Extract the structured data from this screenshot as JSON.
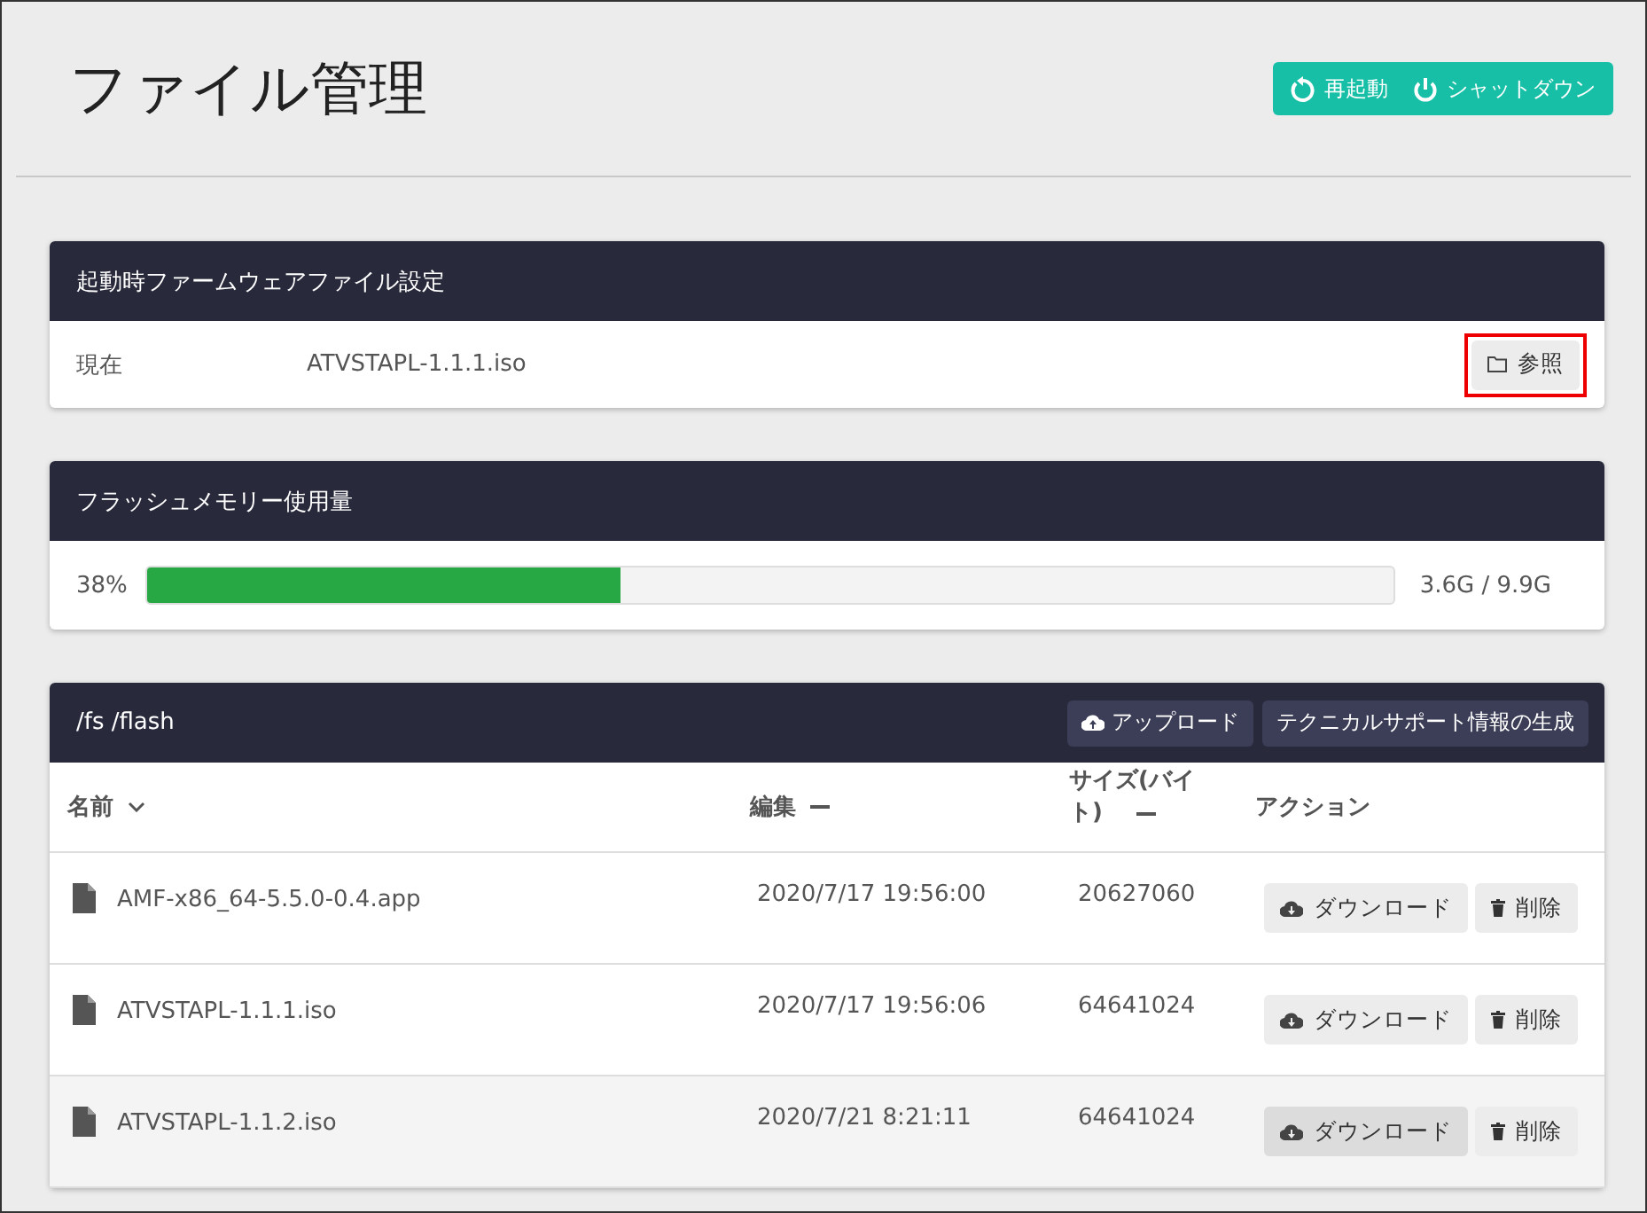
{
  "page": {
    "title": "ファイル管理"
  },
  "header_buttons": [
    {
      "kind": "restart",
      "label": "再起動"
    },
    {
      "kind": "power",
      "label": "シャットダウン"
    }
  ],
  "firmware": {
    "title": "起動時ファームウェアファイル設定",
    "label": "現在",
    "value": "ATVSTAPL-1.1.1.iso",
    "button": {
      "label": "参照",
      "highlighted": true
    }
  },
  "flash": {
    "title": "フラッシュメモリー使用量",
    "percent": "38%",
    "level": 0.38,
    "usage": "3.6G / 9.9G"
  },
  "files": {
    "path": "/fs /flash",
    "buttons": [
      {
        "kind": "upload",
        "label": "アップロード"
      },
      {
        "kind": "plain",
        "label": "テクニカルサポート情報の生成"
      }
    ],
    "columns": [
      {
        "kind": "sortable",
        "label": "名前",
        "sorted": true
      },
      {
        "kind": "sortable",
        "label": "編集",
        "sorted": false
      },
      {
        "kind": "sortable",
        "label": "サイズ(バイト)",
        "sorted": false
      },
      {
        "kind": "plain",
        "label": "アクション"
      }
    ],
    "rows": [
      {
        "name": "AMF-x86_64-5.5.0-0.4.app",
        "edited": "2020/7/17 19:56:00",
        "size": "20627060",
        "download": "ダウンロード",
        "delete": "削除",
        "hovered": false
      },
      {
        "name": "ATVSTAPL-1.1.1.iso",
        "edited": "2020/7/17 19:56:06",
        "size": "64641024",
        "download": "ダウンロード",
        "delete": "削除",
        "hovered": false
      },
      {
        "name": "ATVSTAPL-1.1.2.iso",
        "edited": "2020/7/21 8:21:11",
        "size": "64641024",
        "download": "ダウンロード",
        "delete": "削除",
        "hovered": true
      }
    ]
  }
}
